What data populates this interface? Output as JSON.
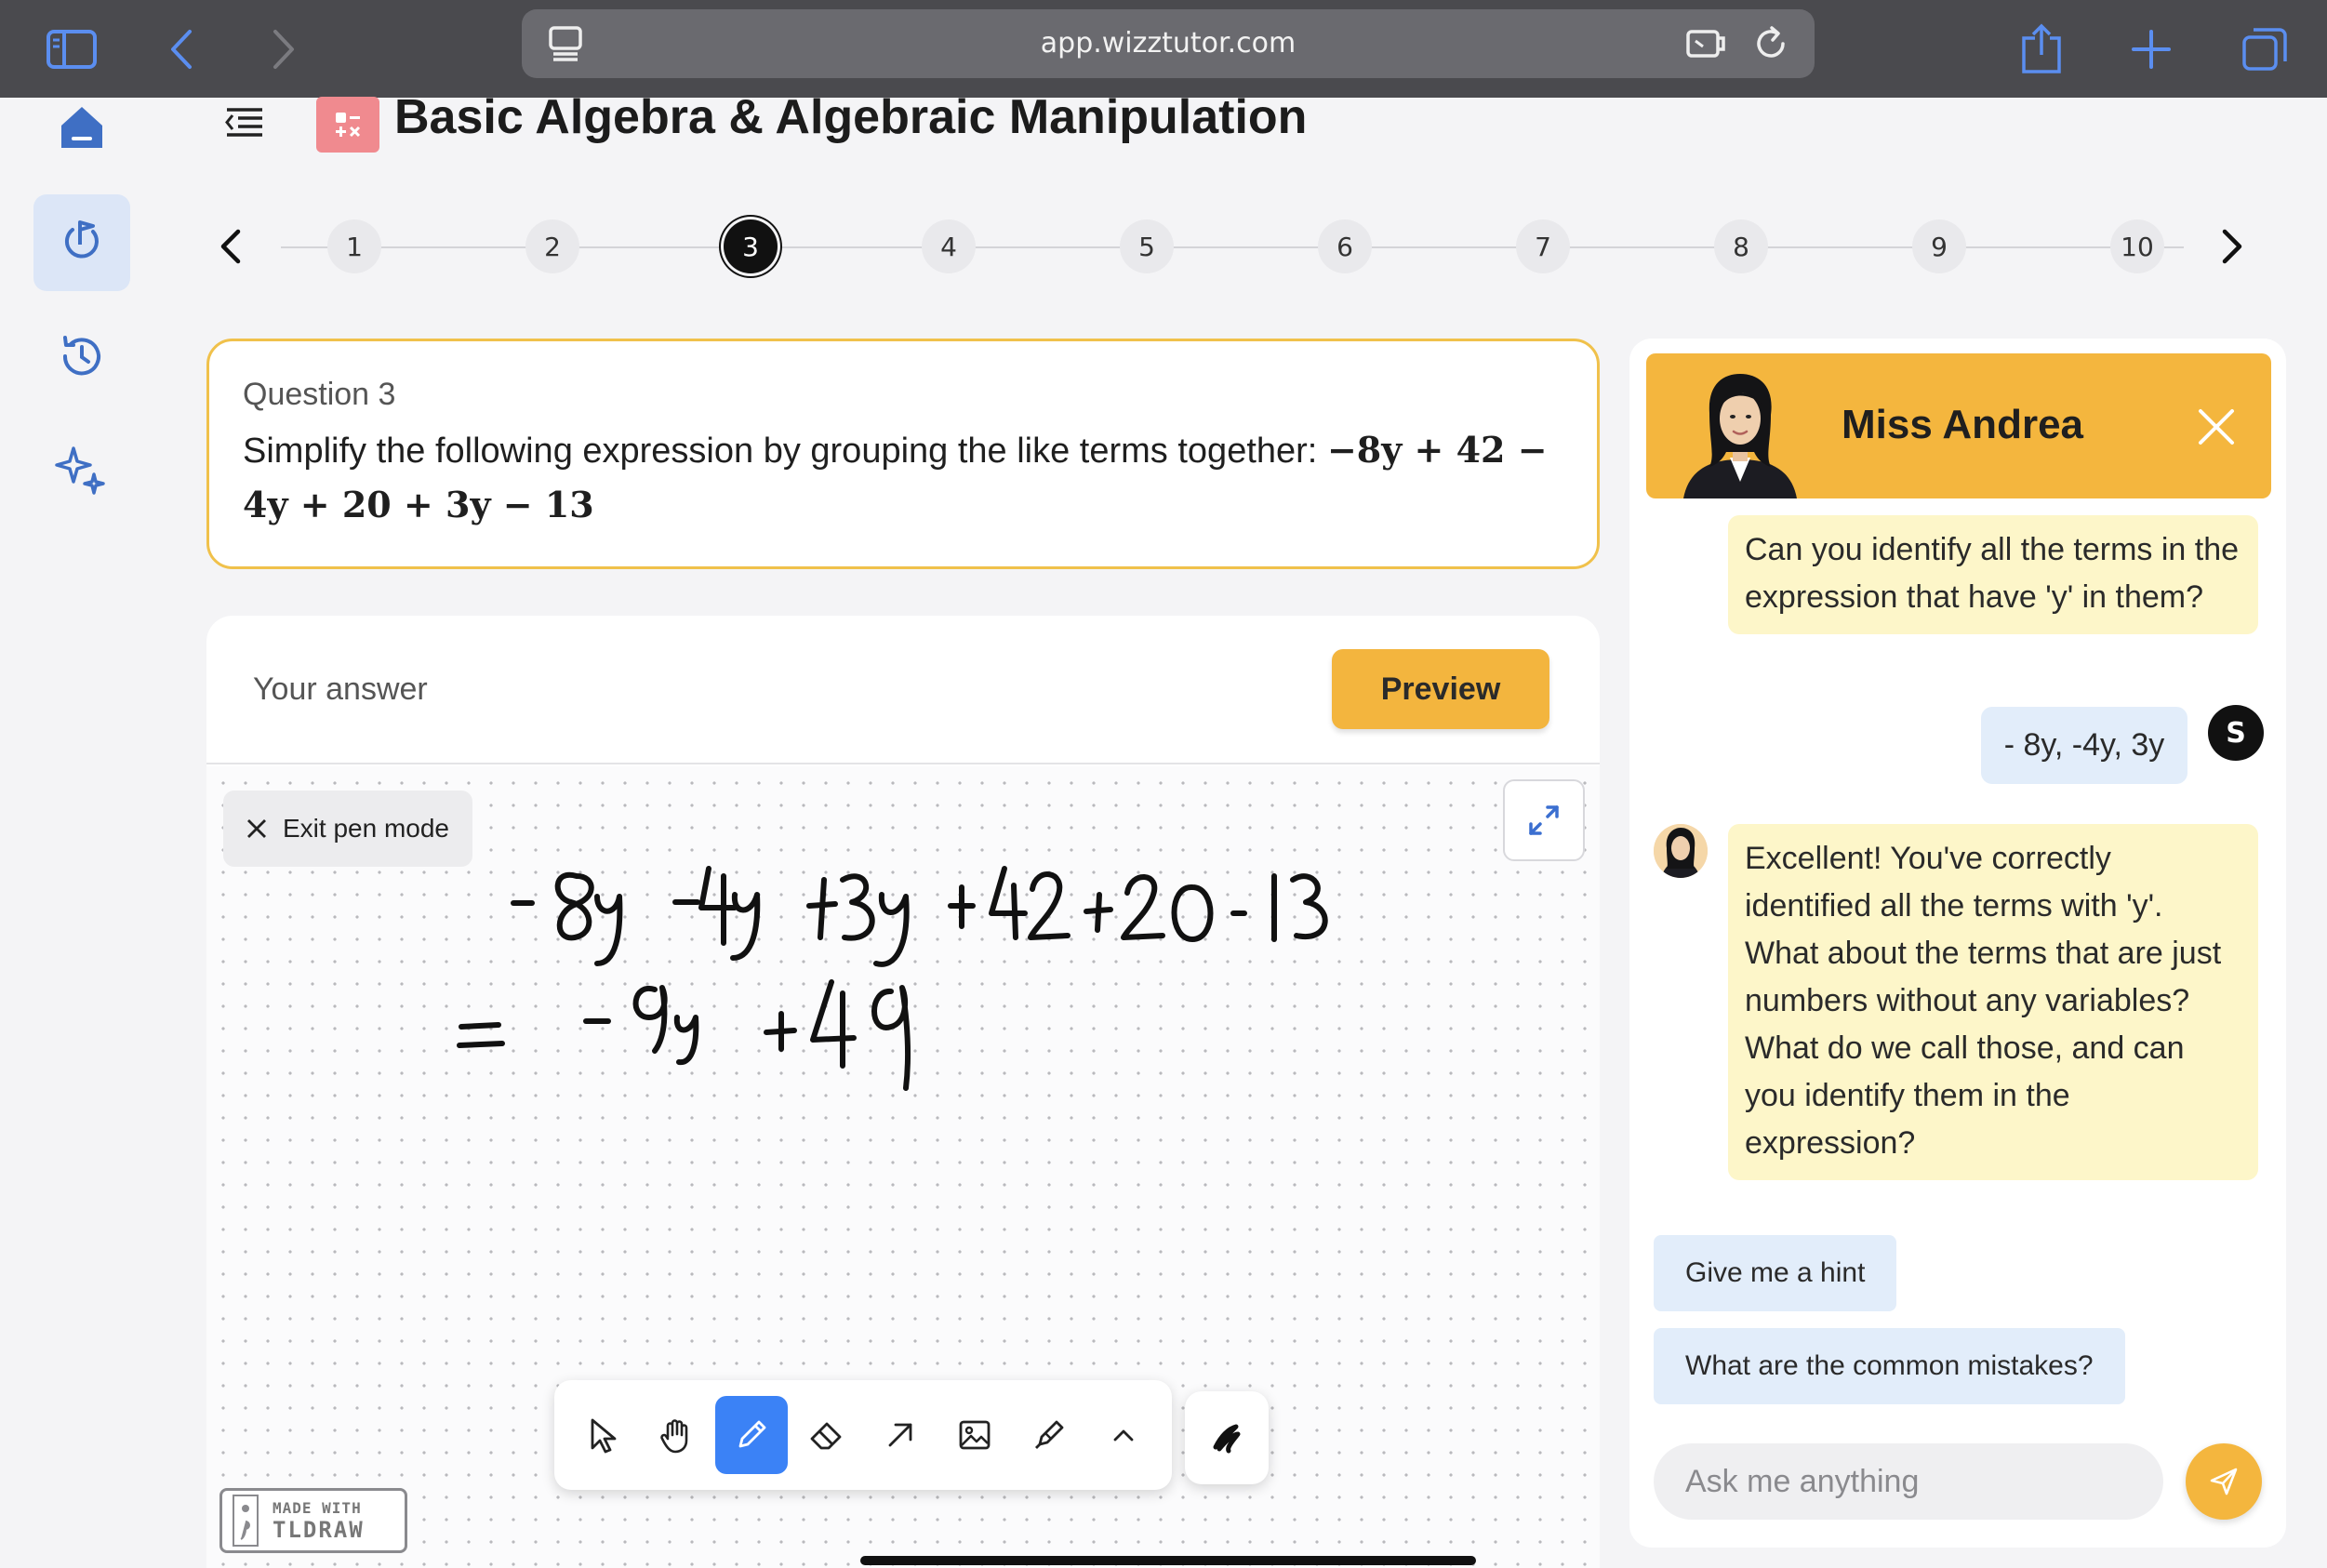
{
  "browser": {
    "url": "app.wizztutor.com"
  },
  "header": {
    "title": "Basic Algebra & Algebraic Manipulation"
  },
  "stepper": {
    "steps": [
      "1",
      "2",
      "3",
      "4",
      "5",
      "6",
      "7",
      "8",
      "9",
      "10"
    ],
    "current_index": 2
  },
  "question": {
    "label": "Question 3",
    "prompt": "Simplify the following expression by grouping the like terms together:",
    "expression": "−8y + 42 − 4y + 20 + 3y − 13"
  },
  "answer": {
    "label": "Your answer",
    "preview_label": "Preview",
    "exit_pen_label": "Exit pen mode",
    "handwriting_line1": "-8y -4y +3y +42+20-13",
    "handwriting_line2": "= -9y +49",
    "tldraw_made": "MADE WITH",
    "tldraw_name": "TLDRAW",
    "tools": [
      "select-icon",
      "hand-icon",
      "pencil-icon",
      "eraser-icon",
      "arrow-icon",
      "image-icon",
      "highlighter-icon",
      "chevron-up-icon"
    ],
    "active_tool": "pencil-icon"
  },
  "chat": {
    "tutor_name": "Miss Andrea",
    "messages": [
      {
        "from": "tutor",
        "text": "Can you identify all the terms in the expression that have 'y' in them?"
      },
      {
        "from": "user",
        "avatar": "S",
        "text": "- 8y, -4y, 3y"
      },
      {
        "from": "tutor",
        "text": "Excellent! You've correctly identified all the terms with 'y'.  What about the terms that are just numbers without any variables? What do we call those, and can you identify them in the expression?"
      }
    ],
    "suggestions": [
      "Give me a hint",
      "What are the common mistakes?"
    ],
    "input_placeholder": "Ask me anything"
  },
  "colors": {
    "accent": "#f4b63e",
    "tutor_bubble": "#fdf6c9",
    "user_bubble": "#e2edfa",
    "active_nav": "#dce6f7",
    "nav_icon": "#3f6fc4",
    "active_tool": "#3b82f6",
    "subject_icon": "#f08a8f"
  }
}
